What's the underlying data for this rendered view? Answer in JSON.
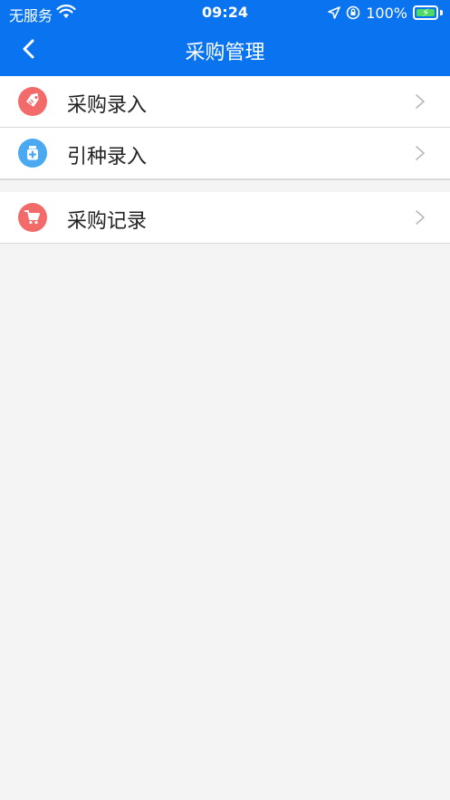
{
  "status_bar": {
    "carrier": "无服务",
    "time": "09:24",
    "battery": "100%"
  },
  "nav": {
    "title": "采购管理"
  },
  "menu": {
    "items": [
      {
        "label": "采购录入",
        "icon": "tag-icon",
        "color": "#f26a6a"
      },
      {
        "label": "引种录入",
        "icon": "medical-bottle-icon",
        "color": "#4aa9f0"
      },
      {
        "label": "采购记录",
        "icon": "cart-icon",
        "color": "#f26a6a"
      }
    ]
  }
}
